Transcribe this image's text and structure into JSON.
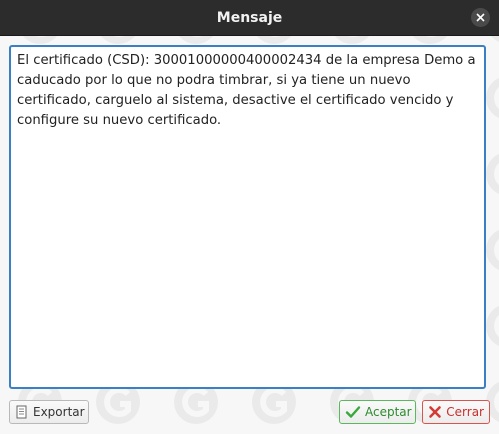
{
  "window": {
    "title": "Mensaje"
  },
  "message": {
    "text": "El certificado (CSD): 30001000000400002434 de la empresa Demo a caducado por lo que no podra timbrar, si ya tiene un nuevo certificado, carguelo al sistema, desactive el certificado vencido y configure su nuevo certificado."
  },
  "buttons": {
    "export_label": "Exportar",
    "accept_label": "Aceptar",
    "close_label": "Cerrar"
  },
  "icons": {
    "close": "close-icon",
    "export": "document-icon",
    "accept": "checkmark-icon",
    "cancel": "x-icon"
  },
  "colors": {
    "titlebar": "#2c2c2c",
    "message_border": "#3b7fc4",
    "accept": "#5cb85c",
    "cancel": "#d9534f"
  }
}
